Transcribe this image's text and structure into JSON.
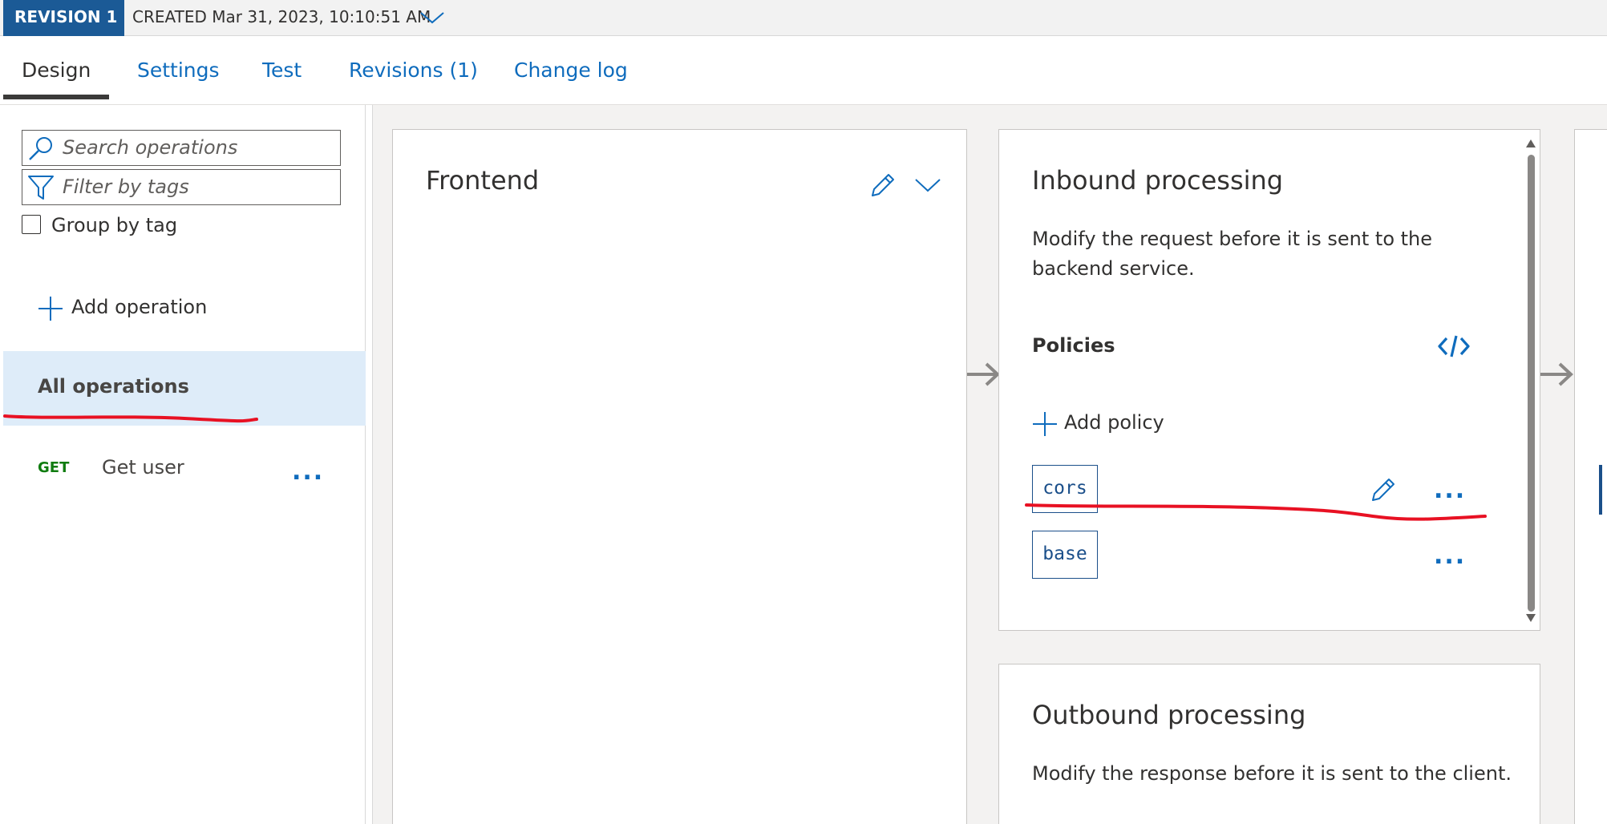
{
  "revision": {
    "badge": "REVISION 1",
    "created": "CREATED Mar 31, 2023, 10:10:51 AM"
  },
  "tabs": [
    {
      "label": "Design"
    },
    {
      "label": "Settings"
    },
    {
      "label": "Test"
    },
    {
      "label": "Revisions (1)"
    },
    {
      "label": "Change log"
    }
  ],
  "sidebar": {
    "search_placeholder": "Search operations",
    "filter_placeholder": "Filter by tags",
    "group_by_tag": "Group by tag",
    "add_operation": "Add operation",
    "all_operations": "All operations",
    "operations": [
      {
        "method": "GET",
        "name": "Get user",
        "more": "..."
      }
    ]
  },
  "frontend": {
    "title": "Frontend"
  },
  "inbound": {
    "title": "Inbound processing",
    "description": "Modify the request before it is sent to the backend service.",
    "policies_label": "Policies",
    "add_policy": "Add policy",
    "policies": [
      {
        "name": "cors",
        "more": "..."
      },
      {
        "name": "base",
        "more": "..."
      }
    ]
  },
  "outbound": {
    "title": "Outbound processing",
    "description": "Modify the response before it is sent to the client."
  },
  "colors": {
    "brand": "#1b5a96",
    "link": "#0f6cbd",
    "get_method": "#107c10",
    "selected_bg": "#deecf9",
    "annotation": "#e81123"
  }
}
